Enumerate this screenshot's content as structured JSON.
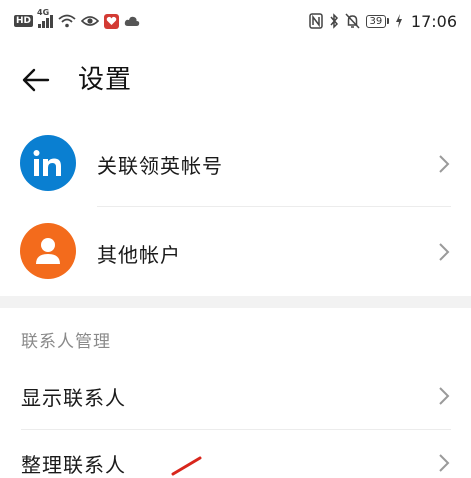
{
  "status_bar": {
    "hd": "HD",
    "network": "4G",
    "battery": "39",
    "time": "17:06"
  },
  "header": {
    "title": "设置"
  },
  "accounts": [
    {
      "label": "关联领英帐号",
      "icon": "linkedin-icon",
      "color": "#0a7fd1"
    },
    {
      "label": "其他帐户",
      "icon": "person-icon",
      "color": "#f36b1c"
    }
  ],
  "contacts_section": {
    "header": "联系人管理",
    "items": [
      {
        "label": "显示联系人"
      },
      {
        "label": "整理联系人"
      }
    ]
  }
}
